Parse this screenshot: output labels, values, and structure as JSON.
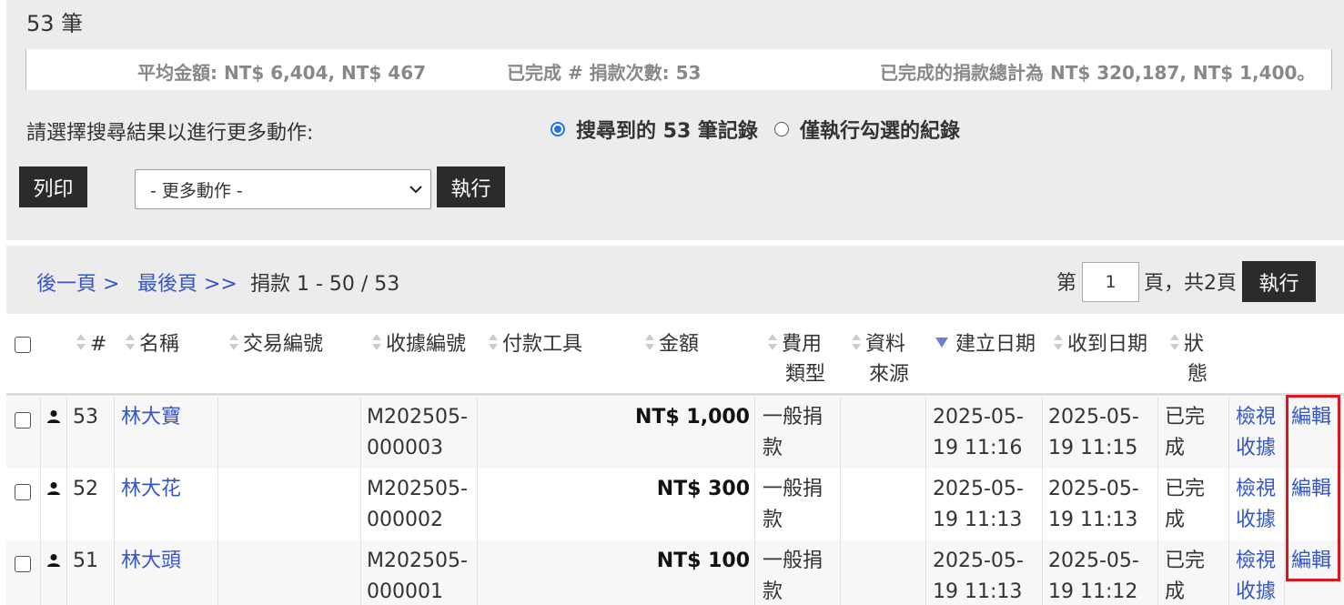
{
  "summary": {
    "count_title": "53 筆",
    "average": "平均金額: NT$ 6,404, NT$ 467",
    "completed_count": "已完成 # 捐款次數: 53",
    "completed_total": "已完成的捐款總計為 NT$ 320,187, NT$ 1,400。"
  },
  "actions": {
    "prompt": "請選擇搜尋結果以進行更多動作:",
    "radio_all": "搜尋到的 53 筆記錄",
    "radio_selected": "僅執行勾選的紀錄",
    "print_label": "列印",
    "more_select_value": "- 更多動作 -",
    "exec_label": "執行"
  },
  "pager": {
    "next": "後一頁 >",
    "last": "最後頁 >>",
    "range": "捐款 1 - 50 / 53",
    "page_prefix": "第",
    "page_value": "1",
    "page_suffix": "頁，共2頁",
    "exec_label": "執行"
  },
  "table": {
    "headers": {
      "num": "#",
      "name": "名稱",
      "txn": "交易編號",
      "receipt": "收據編號",
      "instrument": "付款工具",
      "amount": "金額",
      "fee_type_1": "費用",
      "fee_type_2": "類型",
      "source_1": "資料",
      "source_2": "來源",
      "created": "建立日期",
      "received": "收到日期",
      "status_1": "狀",
      "status_2": "態"
    },
    "rows": [
      {
        "num": "53",
        "name": "林大寶",
        "receipt_1": "M202505-",
        "receipt_2": "000003",
        "amount": "NT$ 1,000",
        "type_1": "一般捐",
        "type_2": "款",
        "created_1": "2025-05-",
        "created_2": "19 11:16",
        "received_1": "2025-05-",
        "received_2": "19 11:15",
        "status_1": "已完",
        "status_2": "成",
        "view_1": "檢視",
        "view_2": "收據",
        "edit": "編輯"
      },
      {
        "num": "52",
        "name": "林大花",
        "receipt_1": "M202505-",
        "receipt_2": "000002",
        "amount": "NT$ 300",
        "type_1": "一般捐",
        "type_2": "款",
        "created_1": "2025-05-",
        "created_2": "19 11:13",
        "received_1": "2025-05-",
        "received_2": "19 11:13",
        "status_1": "已完",
        "status_2": "成",
        "view_1": "檢視",
        "view_2": "收據",
        "edit": "編輯"
      },
      {
        "num": "51",
        "name": "林大頭",
        "receipt_1": "M202505-",
        "receipt_2": "000001",
        "amount": "NT$ 100",
        "type_1": "一般捐",
        "type_2": "款",
        "created_1": "2025-05-",
        "created_2": "19 11:13",
        "received_1": "2025-05-",
        "received_2": "19 11:12",
        "status_1": "已完",
        "status_2": "成",
        "view_1": "檢視",
        "view_2": "收據",
        "edit": "編輯"
      }
    ]
  },
  "colors": {
    "link": "#3556c8",
    "dark_button": "#2b2b2b",
    "highlight": "#e0141e",
    "radio_accent": "#1a73e8"
  }
}
